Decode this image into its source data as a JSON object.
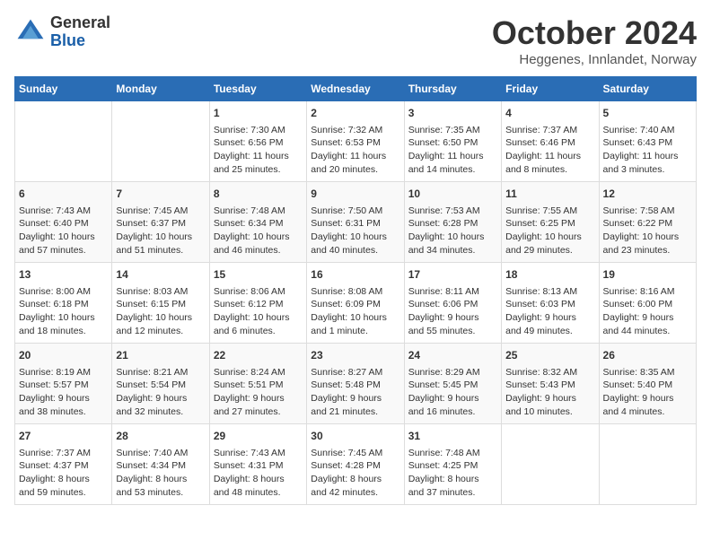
{
  "header": {
    "logo": {
      "general": "General",
      "blue": "Blue"
    },
    "title": "October 2024",
    "subtitle": "Heggenes, Innlandet, Norway"
  },
  "days_of_week": [
    "Sunday",
    "Monday",
    "Tuesday",
    "Wednesday",
    "Thursday",
    "Friday",
    "Saturday"
  ],
  "weeks": [
    [
      {
        "day": "",
        "info": ""
      },
      {
        "day": "",
        "info": ""
      },
      {
        "day": "1",
        "info": "Sunrise: 7:30 AM\nSunset: 6:56 PM\nDaylight: 11 hours\nand 25 minutes."
      },
      {
        "day": "2",
        "info": "Sunrise: 7:32 AM\nSunset: 6:53 PM\nDaylight: 11 hours\nand 20 minutes."
      },
      {
        "day": "3",
        "info": "Sunrise: 7:35 AM\nSunset: 6:50 PM\nDaylight: 11 hours\nand 14 minutes."
      },
      {
        "day": "4",
        "info": "Sunrise: 7:37 AM\nSunset: 6:46 PM\nDaylight: 11 hours\nand 8 minutes."
      },
      {
        "day": "5",
        "info": "Sunrise: 7:40 AM\nSunset: 6:43 PM\nDaylight: 11 hours\nand 3 minutes."
      }
    ],
    [
      {
        "day": "6",
        "info": "Sunrise: 7:43 AM\nSunset: 6:40 PM\nDaylight: 10 hours\nand 57 minutes."
      },
      {
        "day": "7",
        "info": "Sunrise: 7:45 AM\nSunset: 6:37 PM\nDaylight: 10 hours\nand 51 minutes."
      },
      {
        "day": "8",
        "info": "Sunrise: 7:48 AM\nSunset: 6:34 PM\nDaylight: 10 hours\nand 46 minutes."
      },
      {
        "day": "9",
        "info": "Sunrise: 7:50 AM\nSunset: 6:31 PM\nDaylight: 10 hours\nand 40 minutes."
      },
      {
        "day": "10",
        "info": "Sunrise: 7:53 AM\nSunset: 6:28 PM\nDaylight: 10 hours\nand 34 minutes."
      },
      {
        "day": "11",
        "info": "Sunrise: 7:55 AM\nSunset: 6:25 PM\nDaylight: 10 hours\nand 29 minutes."
      },
      {
        "day": "12",
        "info": "Sunrise: 7:58 AM\nSunset: 6:22 PM\nDaylight: 10 hours\nand 23 minutes."
      }
    ],
    [
      {
        "day": "13",
        "info": "Sunrise: 8:00 AM\nSunset: 6:18 PM\nDaylight: 10 hours\nand 18 minutes."
      },
      {
        "day": "14",
        "info": "Sunrise: 8:03 AM\nSunset: 6:15 PM\nDaylight: 10 hours\nand 12 minutes."
      },
      {
        "day": "15",
        "info": "Sunrise: 8:06 AM\nSunset: 6:12 PM\nDaylight: 10 hours\nand 6 minutes."
      },
      {
        "day": "16",
        "info": "Sunrise: 8:08 AM\nSunset: 6:09 PM\nDaylight: 10 hours\nand 1 minute."
      },
      {
        "day": "17",
        "info": "Sunrise: 8:11 AM\nSunset: 6:06 PM\nDaylight: 9 hours\nand 55 minutes."
      },
      {
        "day": "18",
        "info": "Sunrise: 8:13 AM\nSunset: 6:03 PM\nDaylight: 9 hours\nand 49 minutes."
      },
      {
        "day": "19",
        "info": "Sunrise: 8:16 AM\nSunset: 6:00 PM\nDaylight: 9 hours\nand 44 minutes."
      }
    ],
    [
      {
        "day": "20",
        "info": "Sunrise: 8:19 AM\nSunset: 5:57 PM\nDaylight: 9 hours\nand 38 minutes."
      },
      {
        "day": "21",
        "info": "Sunrise: 8:21 AM\nSunset: 5:54 PM\nDaylight: 9 hours\nand 32 minutes."
      },
      {
        "day": "22",
        "info": "Sunrise: 8:24 AM\nSunset: 5:51 PM\nDaylight: 9 hours\nand 27 minutes."
      },
      {
        "day": "23",
        "info": "Sunrise: 8:27 AM\nSunset: 5:48 PM\nDaylight: 9 hours\nand 21 minutes."
      },
      {
        "day": "24",
        "info": "Sunrise: 8:29 AM\nSunset: 5:45 PM\nDaylight: 9 hours\nand 16 minutes."
      },
      {
        "day": "25",
        "info": "Sunrise: 8:32 AM\nSunset: 5:43 PM\nDaylight: 9 hours\nand 10 minutes."
      },
      {
        "day": "26",
        "info": "Sunrise: 8:35 AM\nSunset: 5:40 PM\nDaylight: 9 hours\nand 4 minutes."
      }
    ],
    [
      {
        "day": "27",
        "info": "Sunrise: 7:37 AM\nSunset: 4:37 PM\nDaylight: 8 hours\nand 59 minutes."
      },
      {
        "day": "28",
        "info": "Sunrise: 7:40 AM\nSunset: 4:34 PM\nDaylight: 8 hours\nand 53 minutes."
      },
      {
        "day": "29",
        "info": "Sunrise: 7:43 AM\nSunset: 4:31 PM\nDaylight: 8 hours\nand 48 minutes."
      },
      {
        "day": "30",
        "info": "Sunrise: 7:45 AM\nSunset: 4:28 PM\nDaylight: 8 hours\nand 42 minutes."
      },
      {
        "day": "31",
        "info": "Sunrise: 7:48 AM\nSunset: 4:25 PM\nDaylight: 8 hours\nand 37 minutes."
      },
      {
        "day": "",
        "info": ""
      },
      {
        "day": "",
        "info": ""
      }
    ]
  ]
}
